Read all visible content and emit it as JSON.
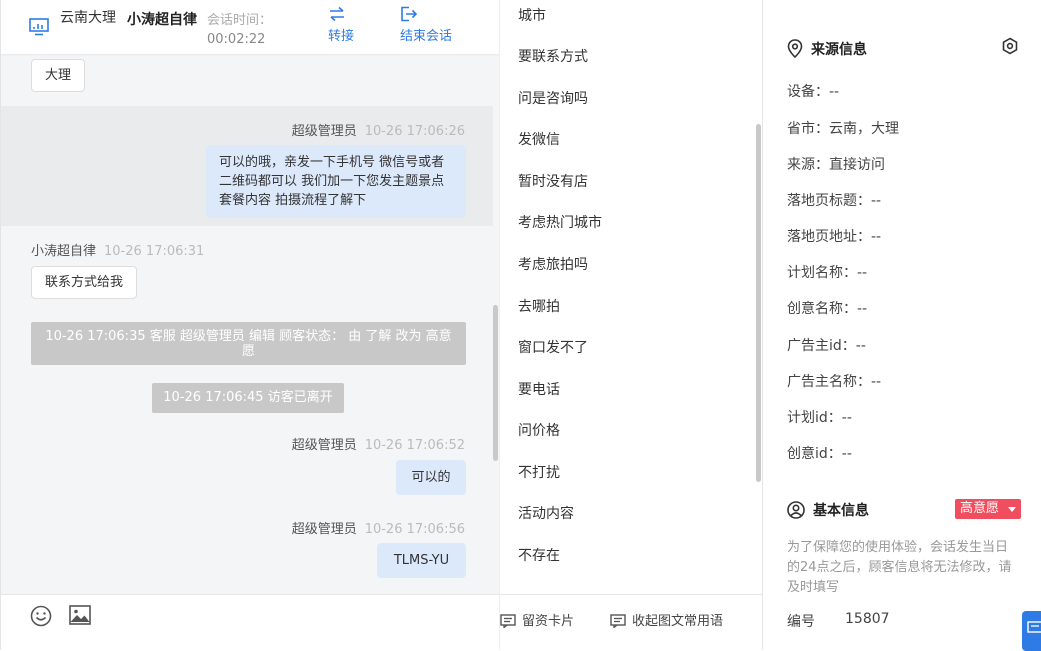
{
  "header": {
    "location": "云南大理",
    "user_name": "小涛超自律",
    "session_time_label": "会话时间：",
    "session_time": "00:02:22",
    "transfer_label": "转接",
    "end_label": "结束会话"
  },
  "chat": {
    "m1_text": "大理",
    "m2_sender": "超级管理员",
    "m2_time": "10-26 17:06:26",
    "m2_text": "可以的哦，亲发一下手机号 微信号或者二维码都可以 我们加一下您发主题景点 套餐内容 拍摄流程了解下",
    "m3_sender": "小涛超自律",
    "m3_time": "10-26 17:06:31",
    "m3_text": "联系方式给我",
    "sys1": "10-26 17:06:35 客服 超级管理员 编辑 顾客状态： 由 了解 改为 高意愿",
    "sys2": "10-26 17:06:45 访客已离开",
    "m4_sender": "超级管理员",
    "m4_time": "10-26 17:06:52",
    "m4_text": "可以的",
    "m5_sender": "超级管理员",
    "m5_time": "10-26 17:06:56",
    "m5_text": "TLMS-YU"
  },
  "composer": {
    "emoji_icon": "smiley-icon",
    "image_icon": "image-icon"
  },
  "phrases": [
    "城市",
    "要联系方式",
    "问是咨询吗",
    "发微信",
    "暂时没有店",
    "考虑热门城市",
    "考虑旅拍吗",
    "去哪拍",
    "窗口发不了",
    "要电话",
    "问价格",
    "不打扰",
    "活动内容",
    "不存在"
  ],
  "phrase_footer": {
    "card_label": "留资卡片",
    "collapse_label": "收起图文常用语"
  },
  "source": {
    "title": "来源信息",
    "rows": [
      "设备：--",
      "省市：云南，大理",
      "来源：直接访问",
      "落地页标题：--",
      "落地页地址：--",
      "计划名称：--",
      "创意名称：--",
      "广告主id：--",
      "广告主名称：--",
      "计划id：--",
      "创意id：--"
    ]
  },
  "basic": {
    "title": "基本信息",
    "status_badge": "高意愿",
    "note": "为了保障您的使用体验，会话发生当日的24点之后，顾客信息将无法修改，请及时填写",
    "id_label": "编号",
    "id_value": "15807"
  },
  "colors": {
    "accent": "#2e7be6",
    "bubble_self": "#dce9fb",
    "badge": "#f04e5e",
    "system_msg": "#c8c8c8"
  }
}
